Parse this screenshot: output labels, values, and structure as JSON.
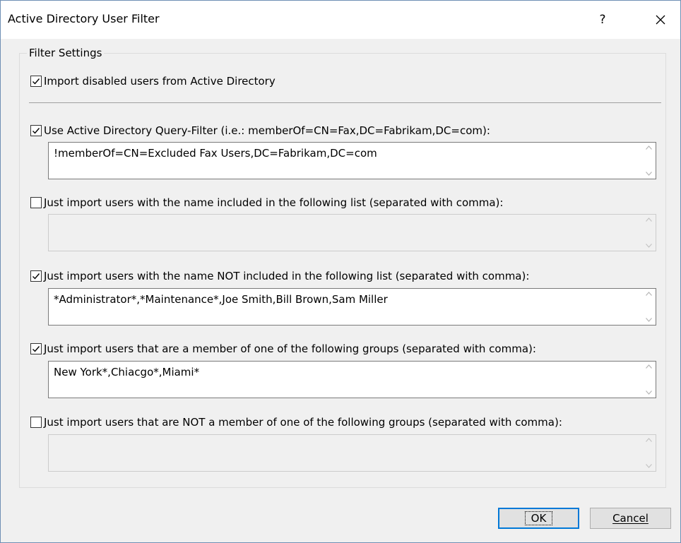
{
  "window": {
    "title": "Active Directory User Filter",
    "help_icon": "question-mark",
    "help_glyph": "?",
    "close_icon": "x-close"
  },
  "group": {
    "legend": "Filter Settings"
  },
  "options": {
    "import_disabled": {
      "label": "Import disabled users from Active Directory",
      "checked": true
    },
    "query_filter": {
      "label": "Use Active Directory Query-Filter (i.e.: memberOf=CN=Fax,DC=Fabrikam,DC=com):",
      "checked": true,
      "value": "!memberOf=CN=Excluded Fax Users,DC=Fabrikam,DC=com"
    },
    "name_included": {
      "label": "Just import users with the name included in the following list (separated with comma):",
      "checked": false,
      "value": ""
    },
    "name_not_included": {
      "label": "Just import users with the name NOT included in the following list (separated with comma):",
      "checked": true,
      "value": "*Administrator*,*Maintenance*,Joe Smith,Bill Brown,Sam Miller"
    },
    "member_of": {
      "label": "Just import users that are a member of one of the following groups (separated with comma):",
      "checked": true,
      "value": "New York*,Chiacgo*,Miami*"
    },
    "not_member_of": {
      "label": "Just import users that are NOT a member of one of the following groups (separated with comma):",
      "checked": false,
      "value": ""
    }
  },
  "buttons": {
    "ok": "OK",
    "cancel": "Cancel"
  },
  "colors": {
    "accent": "#0078d7",
    "dialog_bg": "#f0f0f0",
    "title_bg": "#ffffff"
  }
}
